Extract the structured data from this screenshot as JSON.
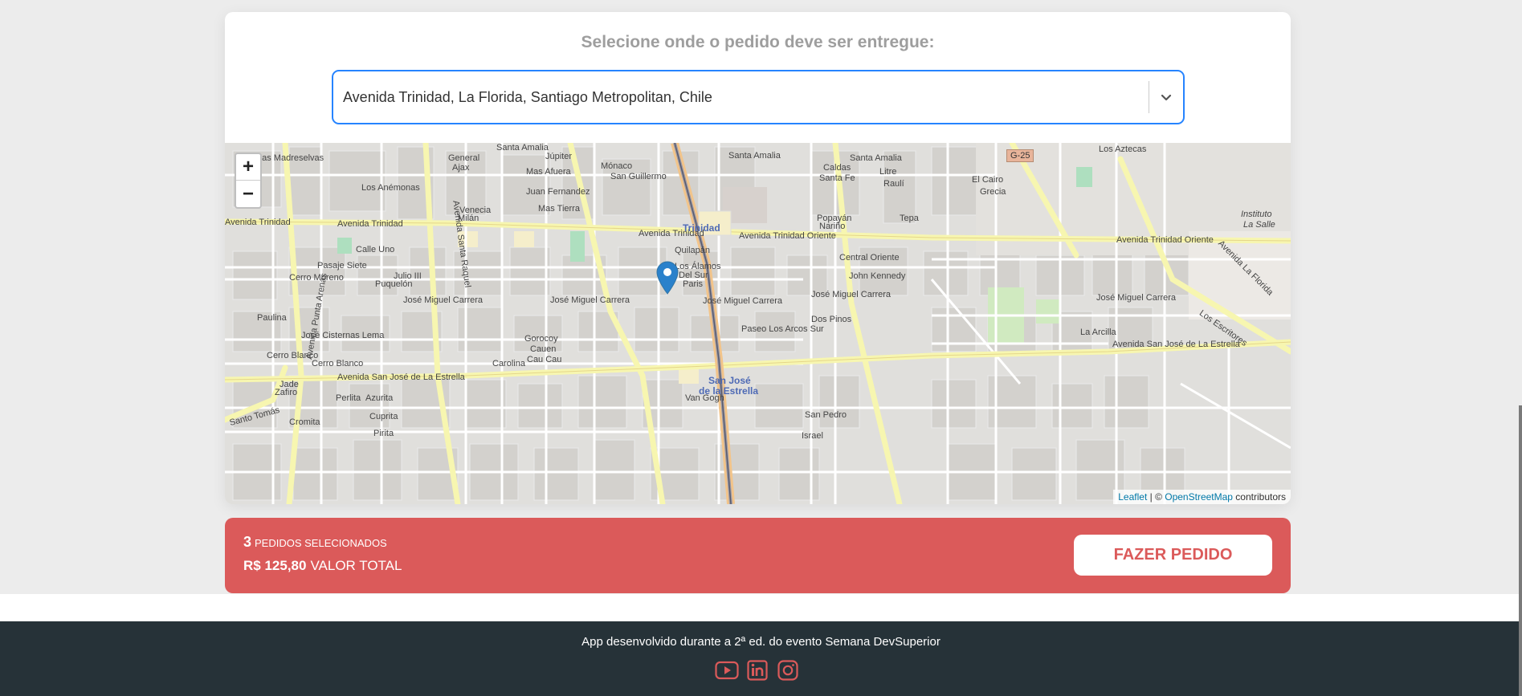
{
  "location_card": {
    "title": "Selecione onde o pedido deve ser entregue:",
    "address_value": "Avenida Trinidad, La Florida, Santiago Metropolitan, Chile"
  },
  "map": {
    "zoom_in": "+",
    "zoom_out": "−",
    "attribution_leaflet": "Leaflet",
    "attribution_sep": " | © ",
    "attribution_osm": "OpenStreetMap",
    "attribution_suffix": " contributors",
    "route_badge": "G-25",
    "labels": {
      "av_trinidad_w": "Avenida Trinidad",
      "av_trinidad_c": "Avenida Trinidad",
      "av_trinidad_e": "Avenida Trinidad",
      "av_trinidad_oriente": "Avenida Trinidad Oriente",
      "av_trinidad_oriente_e": "Avenida Trinidad Oriente",
      "jmc_w": "José Miguel Carrera",
      "jmc_c": "José Miguel Carrera",
      "jmc_c2": "José Miguel Carrera",
      "jmc_e": "José Miguel Carrera",
      "jmc_e2": "José Miguel Carrera",
      "sanjose_w": "Avenida San José de La Estrella",
      "sanjose_e": "Avenida San José de La Estrella",
      "santa_amalia_1": "Santa Amalia",
      "santa_amalia_2": "Santa Amalia",
      "santa_amalia_3": "Santa Amalia",
      "metro_trinidad": "Trinidad",
      "metro_sanjose_1": "San José",
      "metro_sanjose_2": "de la Estrella",
      "instituto_1": "Instituto",
      "instituto_2": "La Salle",
      "av_la_florida": "Avenida La Florida",
      "av_santa_raquel": "Avenida Santa Raquel",
      "av_punta_arenas": "Avenida Punta Arenas",
      "santo_tomas": "Santo Tomás",
      "los_aztecas": "Los Aztecas",
      "cerro_moreno": "Cerro Moreno",
      "central_oriente": "Central Oriente",
      "john_kennedy": "John Kennedy",
      "van_gogh": "Van Gogh",
      "san_pedro": "San Pedro",
      "los_alamos": "Los Álamos",
      "del_sur": "Del Sur",
      "quilapan": "Quilapán",
      "paris": "Paris",
      "dos_pinos": "Dos Pinos",
      "mas_tierra": "Mas Tierra",
      "mas_afuera": "Mas Afuera",
      "juan_fernandez": "Juan Fernandez",
      "san_guillermo": "San Guillermo",
      "monaco": "Mónaco",
      "jupiter": "Júpiter",
      "los_anemonas": "Los Anémonas",
      "los_madreselvas": "Las Madreselvas",
      "pasaje_siete": "Pasaje Siete",
      "calle_uno": "Calle Uno",
      "jose_cisternas_lema": "José Cisternas Lema",
      "cerro_blanco": "Cerro Blanco",
      "cerro_blanco2": "Cerro Blanco",
      "puquelon": "Puquelón",
      "julio_iii": "Julio III",
      "gorocoy": "Gorocoy",
      "cauen": "Cauen",
      "cau_cau": "Cau Cau",
      "carolina": "Carolina",
      "general": "General",
      "ajax": "Ajax",
      "venecia": "Venecia",
      "milan": "Milán",
      "la_arcilla": "La Arcilla",
      "los_escritores": "Los Escritores",
      "paseo_los_arcos": "Paseo Los Arcos Sur",
      "caldas": "Caldas",
      "santa_fe": "Santa Fe",
      "popayan": "Popayán",
      "narino": "Nariño",
      "litre": "Litre",
      "rauli": "Raulí",
      "tepa": "Tepa",
      "el_cairo": "El Cairo",
      "grecia": "Grecia",
      "azurita": "Azurita",
      "perlita": "Perlita",
      "cromita": "Cromita",
      "cuprita": "Cuprita",
      "pirita": "Pirita",
      "israel": "Israel",
      "jade": "Jade",
      "zafiro": "Zafiro",
      "paulina": "Paulina"
    }
  },
  "order_bar": {
    "count": "3",
    "count_label": "PEDIDOS SELECIONADOS",
    "total": "R$ 125,80",
    "total_label": "VALOR TOTAL",
    "button_label": "FAZER PEDIDO"
  },
  "footer": {
    "text": "App desenvolvido durante a 2ª ed. do evento Semana DevSuperior"
  },
  "colors": {
    "accent_red": "#DB5A5A",
    "footer_bg": "#263238",
    "select_border": "#2684FF",
    "marker_blue": "#2A81CB"
  },
  "icons": [
    "chevron-down-icon",
    "map-marker-icon",
    "youtube-icon",
    "linkedin-icon",
    "instagram-icon"
  ]
}
